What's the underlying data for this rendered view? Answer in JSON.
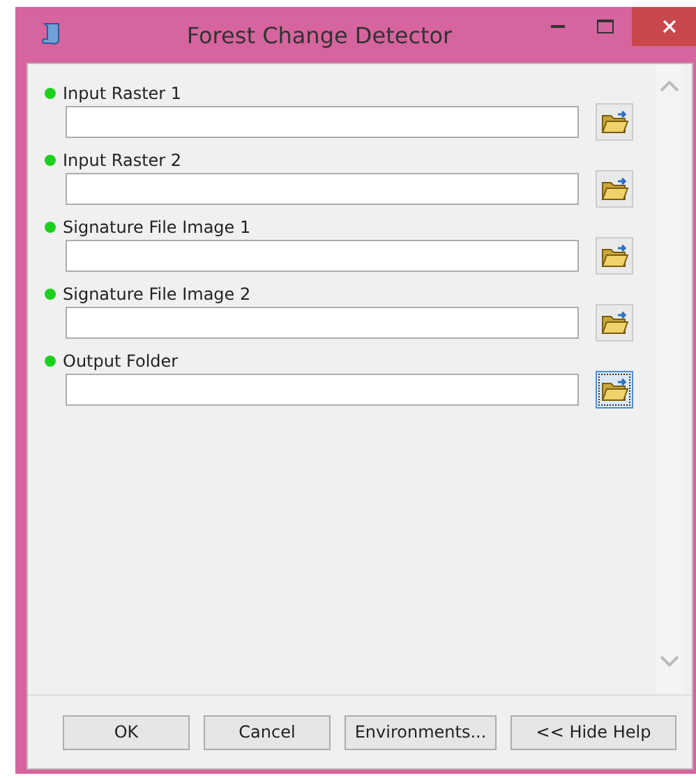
{
  "window": {
    "title": "Forest Change Detector"
  },
  "parameters": [
    {
      "label": "Input Raster 1",
      "required": true,
      "focused": false
    },
    {
      "label": "Input Raster 2",
      "required": true,
      "focused": false
    },
    {
      "label": "Signature File Image 1",
      "required": true,
      "focused": false
    },
    {
      "label": "Signature File Image 2",
      "required": true,
      "focused": false
    },
    {
      "label": "Output Folder",
      "required": true,
      "focused": true
    }
  ],
  "buttons": [
    "OK",
    "Cancel",
    "Environments...",
    "<< Hide Help"
  ]
}
